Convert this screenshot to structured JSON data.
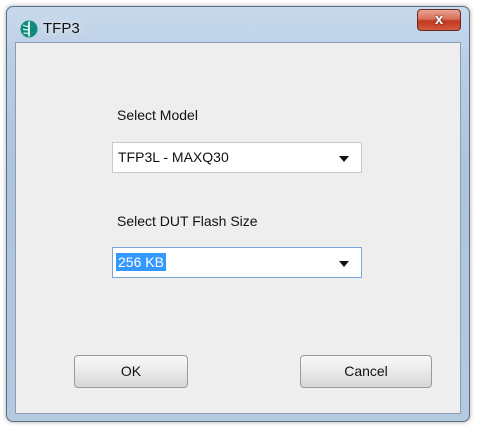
{
  "window": {
    "title": "TFP3",
    "close_glyph": "x",
    "icon": "tfp3-app-icon"
  },
  "form": {
    "model_label": "Select Model",
    "model_value": "TFP3L - MAXQ30",
    "flash_label": "Select DUT Flash Size",
    "flash_value": "256 KB"
  },
  "buttons": {
    "ok": "OK",
    "cancel": "Cancel"
  },
  "colors": {
    "selection": "#3399ff",
    "close": "#c2381f",
    "app_icon": "#0f8a7c"
  }
}
